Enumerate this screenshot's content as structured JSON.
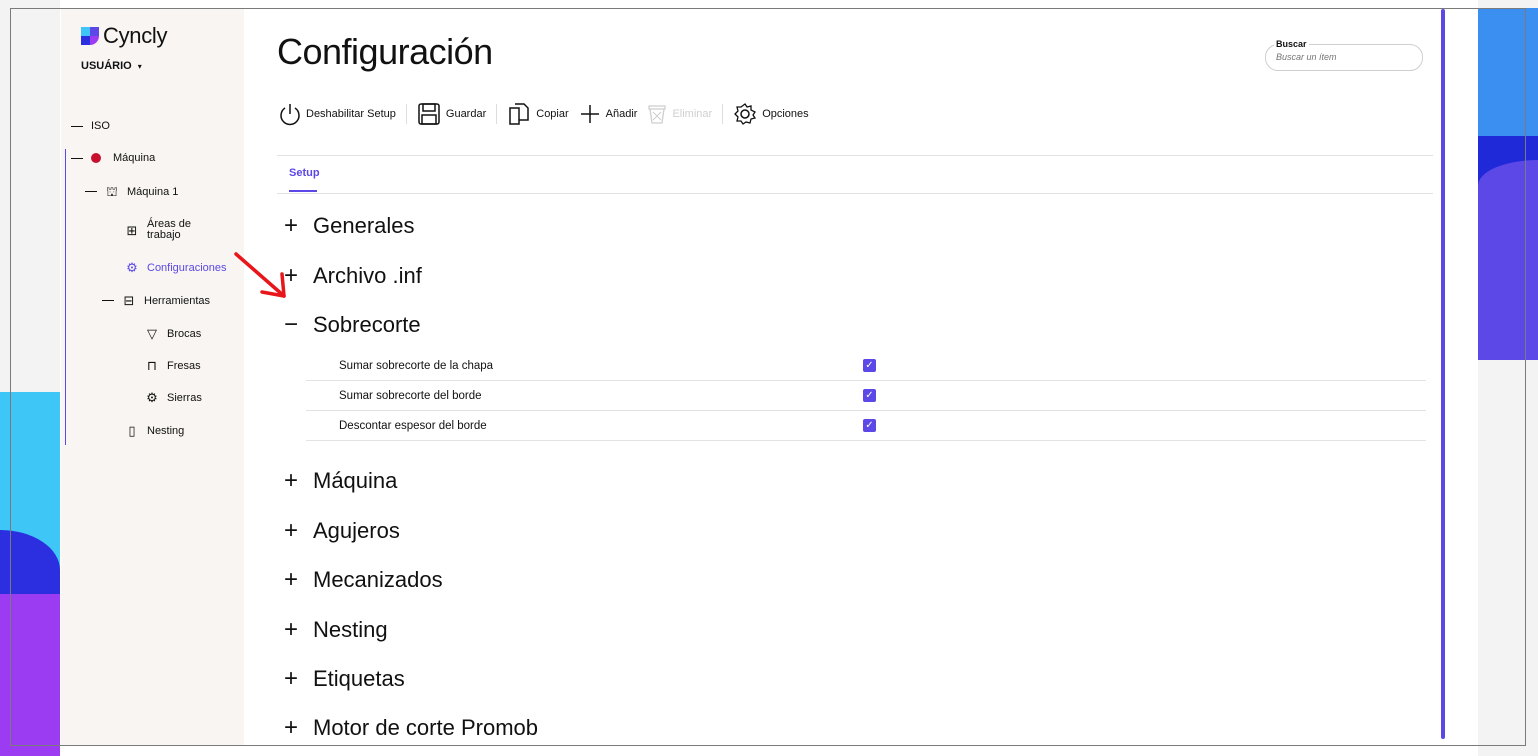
{
  "brand": {
    "name": "Cyncly",
    "user_menu": "USUÁRIO",
    "accent": "#5b48e6"
  },
  "sidebar": {
    "items": [
      {
        "label": "ISO"
      },
      {
        "label": "Máquina"
      },
      {
        "label": "Máquina 1"
      },
      {
        "label": "Áreas de trabajo"
      },
      {
        "label": "Configuraciones"
      },
      {
        "label": "Herramientas"
      },
      {
        "label": "Brocas"
      },
      {
        "label": "Fresas"
      },
      {
        "label": "Sierras"
      },
      {
        "label": "Nesting"
      }
    ]
  },
  "page": {
    "title": "Configuración"
  },
  "search": {
    "label": "Buscar",
    "placeholder": "Buscar un ítem"
  },
  "toolbar": {
    "disable_setup": "Deshabilitar Setup",
    "save": "Guardar",
    "copy": "Copiar",
    "add": "Añadir",
    "delete": "Eliminar",
    "options": "Opciones"
  },
  "tabs": [
    {
      "label": "Setup"
    }
  ],
  "sections": [
    {
      "title": "Generales",
      "expanded": false
    },
    {
      "title": "Archivo .inf",
      "expanded": false
    },
    {
      "title": "Sobrecorte",
      "expanded": true
    },
    {
      "title": "Máquina",
      "expanded": false
    },
    {
      "title": "Agujeros",
      "expanded": false
    },
    {
      "title": "Mecanizados",
      "expanded": false
    },
    {
      "title": "Nesting",
      "expanded": false
    },
    {
      "title": "Etiquetas",
      "expanded": false
    },
    {
      "title": "Motor de corte Promob",
      "expanded": false
    }
  ],
  "sobrecorte_options": [
    {
      "label": "Sumar sobrecorte de la chapa",
      "checked": true
    },
    {
      "label": "Sumar sobrecorte del borde",
      "checked": true
    },
    {
      "label": "Descontar espesor del borde",
      "checked": true
    }
  ]
}
